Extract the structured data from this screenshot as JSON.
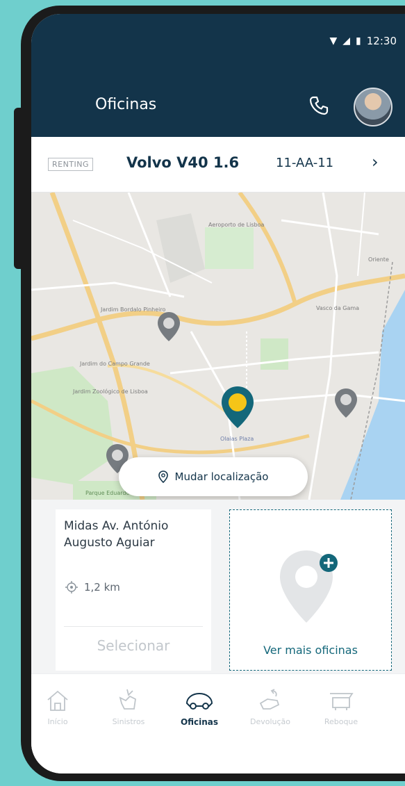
{
  "status_bar": {
    "time": "12:30"
  },
  "header": {
    "title": "Oficinas"
  },
  "vehicle": {
    "tag": "RENTING",
    "model": "Volvo V40 1.6",
    "plate": "11-AA-11"
  },
  "map": {
    "change_location_label": "Mudar localização",
    "place_labels": [
      "Aeroporto de Lisboa",
      "Jardim Bordalo Pinheiro",
      "Jardim Zoológico de Lisboa",
      "Jardim do Campo Grande",
      "Oriente",
      "Vasco da Gama",
      "Olaias Plaza",
      "Parque Eduardo VII"
    ]
  },
  "workshop_card": {
    "name": "Midas Av. António Augusto Aguiar",
    "distance": "1,2 km",
    "select_label": "Selecionar"
  },
  "more_card": {
    "label": "Ver mais oficinas"
  },
  "nav": {
    "items": [
      {
        "label": "Início",
        "icon": "home-icon",
        "active": false
      },
      {
        "label": "Sinistros",
        "icon": "accident-icon",
        "active": false
      },
      {
        "label": "Oficinas",
        "icon": "car-icon",
        "active": true
      },
      {
        "label": "Devolução",
        "icon": "return-icon",
        "active": false
      },
      {
        "label": "Reboque",
        "icon": "tow-icon",
        "active": false
      }
    ]
  },
  "colors": {
    "header_bg": "#13344a",
    "accent_teal": "#13677a",
    "pin_yellow": "#f5c518",
    "pin_grey": "#767b80",
    "page_bg": "#6fcfcd"
  }
}
